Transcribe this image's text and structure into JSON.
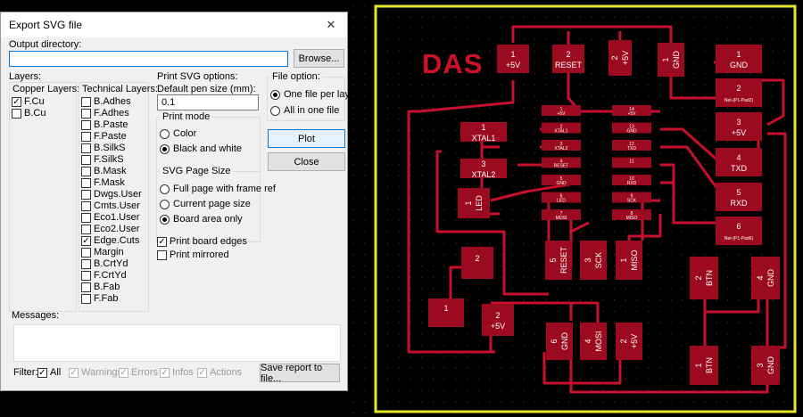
{
  "dialog": {
    "title": "Export SVG file",
    "output_directory_label": "Output directory:",
    "output_directory_value": "",
    "browse_label": "Browse...",
    "layers_label": "Layers:",
    "copper_layers_label": "Copper Layers:",
    "copper_layers": [
      {
        "label": "F.Cu",
        "checked": true
      },
      {
        "label": "B.Cu",
        "checked": false
      }
    ],
    "technical_layers_label": "Technical Layers:",
    "technical_layers": [
      {
        "label": "B.Adhes",
        "checked": false
      },
      {
        "label": "F.Adhes",
        "checked": false
      },
      {
        "label": "B.Paste",
        "checked": false
      },
      {
        "label": "F.Paste",
        "checked": false
      },
      {
        "label": "B.SilkS",
        "checked": false
      },
      {
        "label": "F.SilkS",
        "checked": false
      },
      {
        "label": "B.Mask",
        "checked": false
      },
      {
        "label": "F.Mask",
        "checked": false
      },
      {
        "label": "Dwgs.User",
        "checked": false
      },
      {
        "label": "Cmts.User",
        "checked": false
      },
      {
        "label": "Eco1.User",
        "checked": false
      },
      {
        "label": "Eco2.User",
        "checked": false
      },
      {
        "label": "Edge.Cuts",
        "checked": true
      },
      {
        "label": "Margin",
        "checked": false
      },
      {
        "label": "B.CrtYd",
        "checked": false
      },
      {
        "label": "F.CrtYd",
        "checked": false
      },
      {
        "label": "B.Fab",
        "checked": false
      },
      {
        "label": "F.Fab",
        "checked": false
      }
    ],
    "print_svg_options_label": "Print SVG options:",
    "pen_size_label": "Default pen size (mm):",
    "pen_size_value": "0.1",
    "print_mode_label": "Print mode",
    "print_mode_options": [
      {
        "label": "Color",
        "selected": false
      },
      {
        "label": "Black and white",
        "selected": true
      }
    ],
    "page_size_label": "SVG Page Size",
    "page_size_options": [
      {
        "label": "Full page with  frame ref",
        "selected": false
      },
      {
        "label": "Current page size",
        "selected": false
      },
      {
        "label": "Board area only",
        "selected": true
      }
    ],
    "print_board_edges_label": "Print board edges",
    "print_board_edges_checked": true,
    "print_mirrored_label": "Print mirrored",
    "print_mirrored_checked": false,
    "file_option_label": "File option:",
    "file_options": [
      {
        "label": "One file per layer",
        "selected": true
      },
      {
        "label": "All in one file",
        "selected": false
      }
    ],
    "plot_label": "Plot",
    "close_label": "Close",
    "messages_label": "Messages:",
    "filter_label": "Filter:",
    "filters": [
      {
        "label": "All",
        "checked": true,
        "enabled": true
      },
      {
        "label": "Warnings",
        "checked": true,
        "enabled": false
      },
      {
        "label": "Errors",
        "checked": true,
        "enabled": false
      },
      {
        "label": "Infos",
        "checked": true,
        "enabled": false
      },
      {
        "label": "Actions",
        "checked": true,
        "enabled": false
      }
    ],
    "save_report_label": "Save report to file..."
  },
  "pcb": {
    "board_title": "DAS",
    "colors": {
      "background": "#000000",
      "copper": "#c8102e",
      "pad": "#9b0a1f",
      "edge": "#e6e62e",
      "text": "#ffffff",
      "grid": "#3a3a3a"
    },
    "pads": [
      {
        "id": "p5v_top",
        "num": "1",
        "name": "+5V"
      },
      {
        "id": "reset_top",
        "num": "2",
        "name": "RESET"
      },
      {
        "id": "p5v_v",
        "num": "2",
        "name": "+5V"
      },
      {
        "id": "gnd_v",
        "num": "1",
        "name": "GND"
      },
      {
        "id": "hdr1",
        "num": "1",
        "name": "GND"
      },
      {
        "id": "hdr2",
        "num": "2",
        "name": "Net-(P1-Pad2)"
      },
      {
        "id": "hdr3",
        "num": "3",
        "name": "+5V"
      },
      {
        "id": "hdr4",
        "num": "4",
        "name": "TXD"
      },
      {
        "id": "hdr5",
        "num": "5",
        "name": "RXD"
      },
      {
        "id": "hdr6",
        "num": "6",
        "name": "Net-(P1-Pad6)"
      },
      {
        "id": "led",
        "num": "1",
        "name": "LED"
      },
      {
        "id": "xtal1",
        "num": "1",
        "name": "XTAL1"
      },
      {
        "id": "xtal2",
        "num": "3",
        "name": "XTAL2"
      },
      {
        "id": "pad2",
        "num": "2",
        "name": ""
      },
      {
        "id": "pad1",
        "num": "1",
        "name": ""
      },
      {
        "id": "p5v_bot",
        "num": "2",
        "name": "+5V"
      },
      {
        "id": "reset_v",
        "num": "5",
        "name": "RESET"
      },
      {
        "id": "sck_v",
        "num": "3",
        "name": "SCK"
      },
      {
        "id": "miso_v",
        "num": "1",
        "name": "MISO"
      },
      {
        "id": "btn_v",
        "num": "2",
        "name": "BTN"
      },
      {
        "id": "gnd_v2",
        "num": "4",
        "name": "GND"
      },
      {
        "id": "gnd_b",
        "num": "6",
        "name": "GND"
      },
      {
        "id": "mosi_b",
        "num": "4",
        "name": "MOSI"
      },
      {
        "id": "p5v_b2",
        "num": "2",
        "name": "+5V"
      },
      {
        "id": "btn_b",
        "num": "1",
        "name": "BTN"
      },
      {
        "id": "gnd_b3",
        "num": "3",
        "name": "GND"
      }
    ],
    "ic_left": [
      "+5V",
      "XTAL1",
      "XTAL2",
      "RESET",
      "GND",
      "LED",
      "MOSI"
    ],
    "ic_left_nums": [
      "1",
      "2",
      "3",
      "4",
      "5",
      "6",
      "7"
    ],
    "ic_right": [
      "+5V",
      "GND",
      "TXD",
      "",
      "RXD",
      "SCK",
      "MISO"
    ],
    "ic_right_nums": [
      "14",
      "13",
      "12",
      "11",
      "10",
      "9",
      "8"
    ]
  }
}
